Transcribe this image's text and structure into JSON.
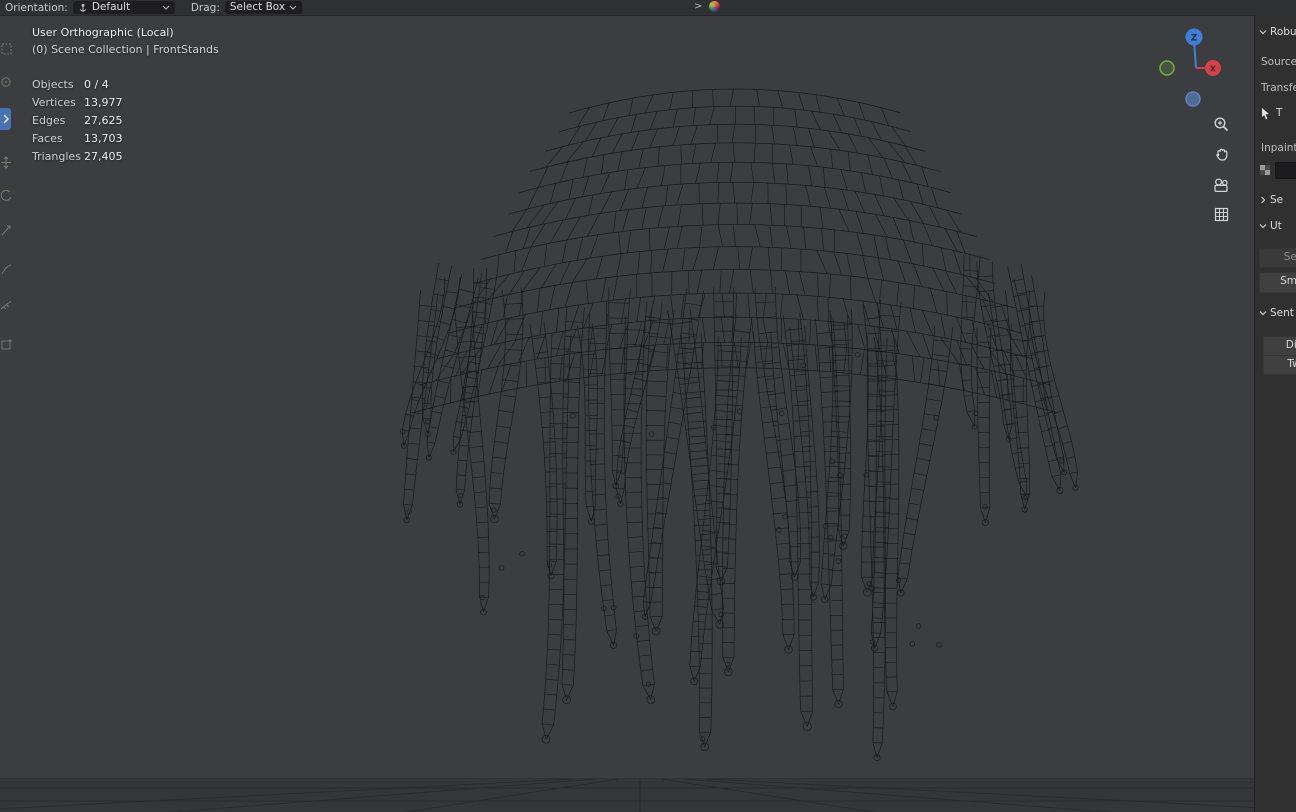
{
  "topbar": {
    "orientation_label": "Orientation:",
    "orientation_value": "Default",
    "drag_label": "Drag:",
    "drag_value": "Select Box",
    "breadcrumb_chevron": ">"
  },
  "overlay": {
    "view_label": "User Orthographic (Local)",
    "context_label": "(0) Scene Collection | FrontStands",
    "stats": [
      {
        "label": "Objects",
        "value": "0 / 4"
      },
      {
        "label": "Vertices",
        "value": "13,977"
      },
      {
        "label": "Edges",
        "value": "27,625"
      },
      {
        "label": "Faces",
        "value": "13,703"
      },
      {
        "label": "Triangles",
        "value": "27,405"
      }
    ]
  },
  "gizmo": {
    "z_label": "Z",
    "x_label": "X"
  },
  "right_panel": {
    "section_top": "Robu",
    "sources_label": "Source",
    "transfer_label": "Transfe",
    "transfer_value": "T",
    "inpaint_label": "Inpaint",
    "subsection_collapsed": "Se",
    "subsection_open": "Ut",
    "select_button": "Sele",
    "smooth_button": "Smoo",
    "section_bottom": "Sent",
    "disable_button": "Dis",
    "twist_button": "Tw"
  },
  "icons": {
    "zoom": "magnifier-plus",
    "pan": "hand",
    "camera": "camera",
    "grid": "grid-ortho",
    "gizmo": "axis-navigation-ball"
  },
  "colors": {
    "accent_blue": "#4772b3",
    "axis_x_red": "#cf4449",
    "axis_z_blue": "#3f7fd6",
    "axis_y_green": "#6fae3e",
    "viewport_bg": "#3c3d40",
    "floor_bg": "#35363a",
    "wireframe": "#18181a"
  }
}
